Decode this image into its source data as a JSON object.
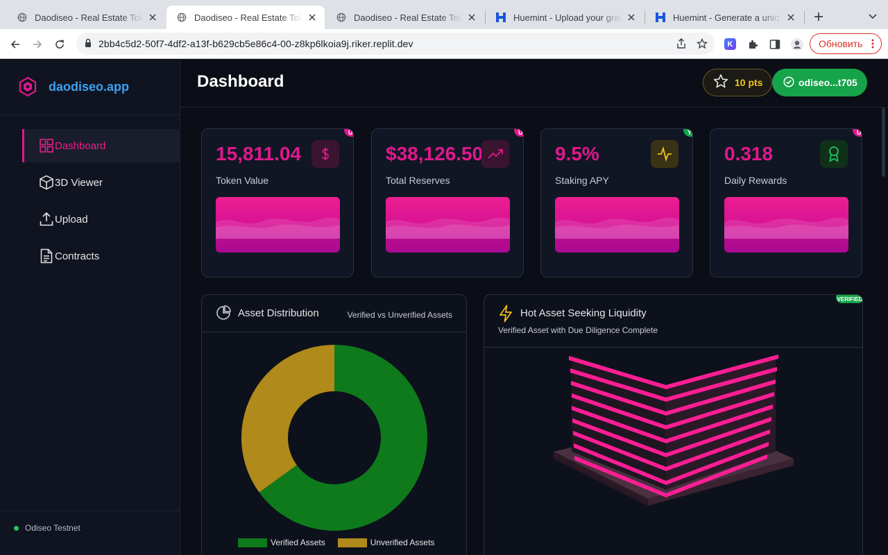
{
  "browser": {
    "tabs": [
      {
        "title": "Daodiseo - Real Estate Tokenization",
        "icon": "globe-icon",
        "active": false
      },
      {
        "title": "Daodiseo - Real Estate Tokenization",
        "icon": "globe-icon",
        "active": true
      },
      {
        "title": "Daodiseo - Real Estate Tokenization",
        "icon": "globe-icon",
        "active": false
      },
      {
        "title": "Huemint - Upload your graphic",
        "icon": "huemint-icon",
        "active": false
      },
      {
        "title": "Huemint - Generate a unique",
        "icon": "huemint-icon",
        "active": false
      }
    ],
    "url": "2bb4c5d2-50f7-4df2-a13f-b629cb5e86c4-00-z8kp6lkoia9j.riker.replit.dev",
    "update_label": "Обновить",
    "extension_label": "K"
  },
  "app": {
    "brand": "daodiseo.app",
    "nav": [
      {
        "label": "Dashboard",
        "icon": "grid-icon",
        "active": true
      },
      {
        "label": "3D Viewer",
        "icon": "cube-icon",
        "active": false
      },
      {
        "label": "Upload",
        "icon": "upload-icon",
        "active": false
      },
      {
        "label": "Contracts",
        "icon": "document-icon",
        "active": false
      }
    ],
    "network": "Odiseo Testnet",
    "network_status_color": "#22c55e"
  },
  "header": {
    "title": "Dashboard",
    "points": "10 pts",
    "wallet": "odiseo...t705"
  },
  "stats": [
    {
      "value": "15,811.04",
      "label": "Token Value",
      "icon": "dollar-icon",
      "accent": "#e0188c",
      "tag": "UL",
      "tag_color": "#e0188c"
    },
    {
      "value": "$38,126.50",
      "label": "Total Reserves",
      "icon": "trending-up-icon",
      "accent": "#e0188c",
      "tag": "UL",
      "tag_color": "#e0188c"
    },
    {
      "value": "9.5%",
      "label": "Staking APY",
      "icon": "activity-icon",
      "accent": "#f5c518",
      "tag": "YE",
      "tag_color": "#16a34a"
    },
    {
      "value": "0.318",
      "label": "Daily Rewards",
      "icon": "award-icon",
      "accent": "#22c55e",
      "tag": "UL",
      "tag_color": "#e0188c"
    }
  ],
  "distribution": {
    "title": "Asset Distribution",
    "subtitle": "Verified vs Unverified Assets",
    "icon": "pie-chart-icon"
  },
  "chart_data": {
    "type": "pie",
    "title": "Asset Distribution",
    "series": [
      {
        "name": "Verified Assets",
        "value": 65,
        "color": "#0e7a1c"
      },
      {
        "name": "Unverified Assets",
        "value": 35,
        "color": "#b08a1a"
      }
    ],
    "donut": true,
    "legend": "bottom"
  },
  "hot_asset": {
    "title": "Hot Asset Seeking Liquidity",
    "subtitle": "Verified Asset with Due Diligence Complete",
    "badge": "VERIFIED",
    "icon": "lightning-icon"
  }
}
